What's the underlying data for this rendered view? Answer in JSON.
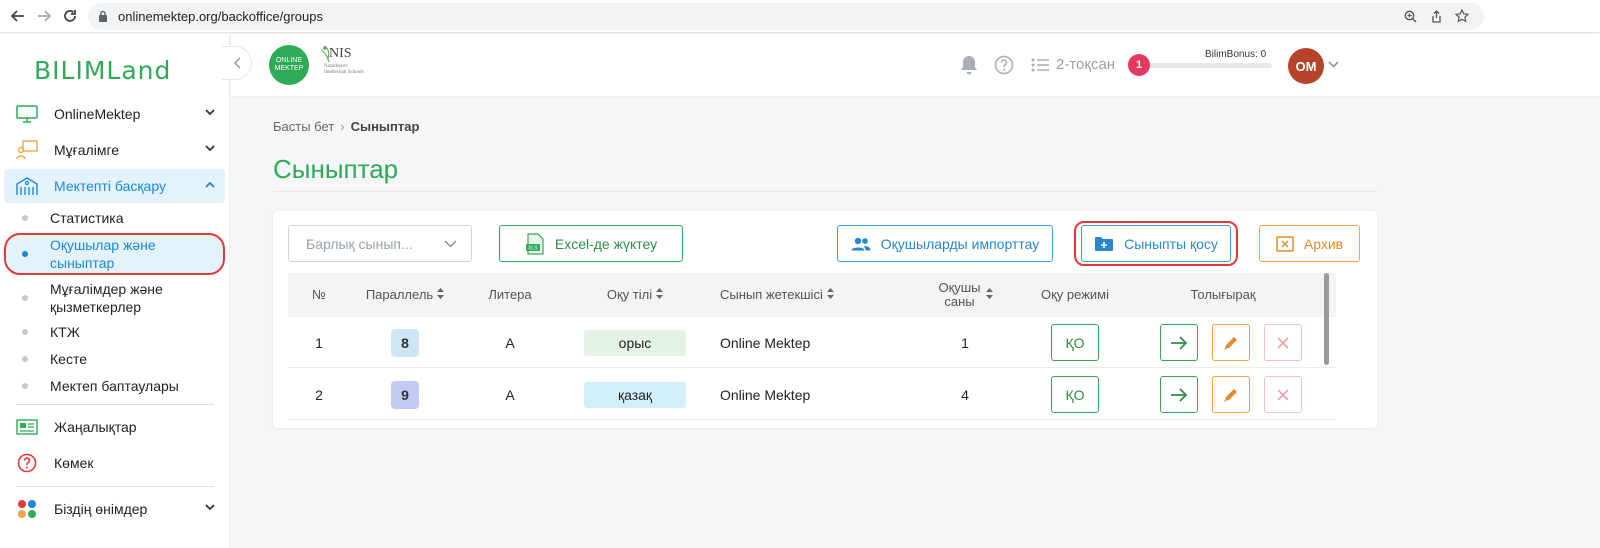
{
  "browser": {
    "url": "onlinemektep.org/backoffice/groups"
  },
  "sidebar": {
    "logo": "BILIMLand",
    "items": [
      {
        "label": "OnlineMektep"
      },
      {
        "label": "Мұғалімге"
      },
      {
        "label": "Мектепті басқару"
      }
    ],
    "subitems": [
      {
        "label": "Статистика"
      },
      {
        "label": "Оқушылар және сыныптар"
      },
      {
        "label": "Мұғалімдер және қызметкерлер"
      },
      {
        "label": "КТЖ"
      },
      {
        "label": "Кесте"
      },
      {
        "label": "Мектеп баптаулары"
      }
    ],
    "bottom_items": [
      {
        "label": "Жаңалықтар"
      },
      {
        "label": "Көмек"
      },
      {
        "label": "Біздің өнімдер"
      }
    ]
  },
  "header": {
    "om_logo": "ONLINE MEKTEP",
    "nis_logo": "NIS",
    "nis_sub": "Nazarbayev Intellectual Schools",
    "quarter": "2-тоқсан",
    "bonus_label": "BilimBonus: 0",
    "bonus_level": "1",
    "avatar": "OM"
  },
  "breadcrumb": {
    "home": "Басты бет",
    "current": "Сыныптар"
  },
  "page_title": "Сыныптар",
  "toolbar": {
    "select_placeholder": "Барлық сынып...",
    "excel": "Excel-де жүктеу",
    "import": "Оқушыларды импорттау",
    "add_class": "Сыныпты қосу",
    "archive": "Архив"
  },
  "table": {
    "headers": {
      "num": "№",
      "parallel": "Параллель",
      "litera": "Литера",
      "lang": "Оқу тілі",
      "teacher": "Сынып жетекшісі",
      "students": "Оқушы саны",
      "mode": "Оқу режимі",
      "extra": "Толығырақ"
    },
    "rows": [
      {
        "num": "1",
        "parallel": "8",
        "litera": "А",
        "lang": "орыс",
        "teacher": "Online Mektep",
        "students": "1",
        "mode": "ҚО"
      },
      {
        "num": "2",
        "parallel": "9",
        "litera": "А",
        "lang": "қазақ",
        "teacher": "Online Mektep",
        "students": "4",
        "mode": "ҚО"
      }
    ]
  },
  "colors": {
    "brand_green": "#2dab57",
    "accent_blue": "#1e88d6",
    "highlight_red": "#e53935",
    "orange": "#f0a54a",
    "badge_8": "#cfe6f7",
    "badge_9": "#c4cbf2",
    "chip_ru": "#e4f3e6",
    "chip_kz": "#d2f0fb"
  }
}
